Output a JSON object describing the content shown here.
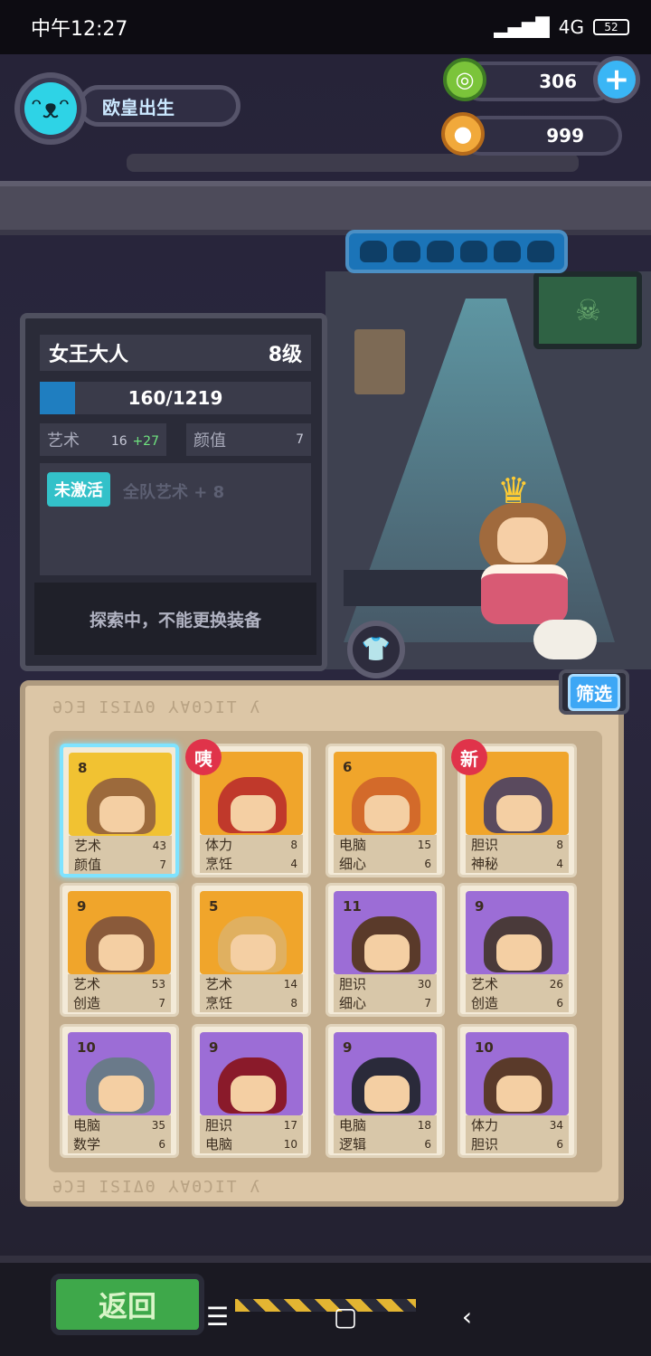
{
  "status_bar": {
    "time": "中午12:27",
    "network": "4G",
    "battery": "52"
  },
  "profile": {
    "name": "欧皇出生"
  },
  "currencies": {
    "gems": "306",
    "coins": "999",
    "plus_label": "+"
  },
  "colors": {
    "accent_cyan": "#2ed3e6",
    "xp_blue": "#1f7ec0",
    "badge_red": "#e0334a",
    "back_green": "#3ea84a"
  },
  "character": {
    "name": "女王大人",
    "level": "8级",
    "xp": "160/1219",
    "xp_fraction": 0.131,
    "stat1_label": "艺术",
    "stat1_value": "16",
    "stat1_bonus": "+27",
    "stat2_label": "颜值",
    "stat2_value": "7",
    "skill_status": "未激活",
    "skill_desc": "全队艺术 + 8",
    "notice": "探索中，不能更换装备"
  },
  "filter_label": "筛选",
  "glyph_border": "ƏƆƎ ISIΔΘ ⅄∀ΘƆIT ʎ",
  "cards": [
    {
      "level": "8",
      "badge": "",
      "s1": "艺术",
      "v1": "43",
      "s2": "颜值",
      "v2": "7",
      "bg": "#f1c232",
      "hair": "#9c6a3c",
      "selected": true
    },
    {
      "level": "",
      "badge": "咦",
      "s1": "体力",
      "v1": "8",
      "s2": "烹饪",
      "v2": "4",
      "bg": "#f0a52b",
      "hair": "#c0392b"
    },
    {
      "level": "6",
      "badge": "",
      "s1": "电脑",
      "v1": "15",
      "s2": "细心",
      "v2": "6",
      "bg": "#f0a52b",
      "hair": "#d36a2a"
    },
    {
      "level": "",
      "badge": "新",
      "s1": "胆识",
      "v1": "8",
      "s2": "神秘",
      "v2": "4",
      "bg": "#f0a52b",
      "hair": "#5a4a5e"
    },
    {
      "level": "9",
      "badge": "",
      "s1": "艺术",
      "v1": "53",
      "s2": "创造",
      "v2": "7",
      "bg": "#f0a52b",
      "hair": "#8a5a3a"
    },
    {
      "level": "5",
      "badge": "",
      "s1": "艺术",
      "v1": "14",
      "s2": "烹饪",
      "v2": "8",
      "bg": "#f0a52b",
      "hair": "#e0b060"
    },
    {
      "level": "11",
      "badge": "",
      "s1": "胆识",
      "v1": "30",
      "s2": "细心",
      "v2": "7",
      "bg": "#9c6dd6",
      "hair": "#5a3a2a"
    },
    {
      "level": "9",
      "badge": "",
      "s1": "艺术",
      "v1": "26",
      "s2": "创造",
      "v2": "6",
      "bg": "#9c6dd6",
      "hair": "#4a3a3a"
    },
    {
      "level": "10",
      "badge": "",
      "s1": "电脑",
      "v1": "35",
      "s2": "数学",
      "v2": "6",
      "bg": "#9c6dd6",
      "hair": "#6a7a8a"
    },
    {
      "level": "9",
      "badge": "",
      "s1": "胆识",
      "v1": "17",
      "s2": "电脑",
      "v2": "10",
      "bg": "#9c6dd6",
      "hair": "#8a1a2a"
    },
    {
      "level": "9",
      "badge": "",
      "s1": "电脑",
      "v1": "18",
      "s2": "逻辑",
      "v2": "6",
      "bg": "#9c6dd6",
      "hair": "#2a2a3a"
    },
    {
      "level": "10",
      "badge": "",
      "s1": "体力",
      "v1": "34",
      "s2": "胆识",
      "v2": "6",
      "bg": "#9c6dd6",
      "hair": "#5a3a2a"
    }
  ],
  "back_label": "返回",
  "nav": {
    "menu_icon": "menu-icon",
    "home_icon": "home-icon",
    "back_icon": "back-icon"
  }
}
